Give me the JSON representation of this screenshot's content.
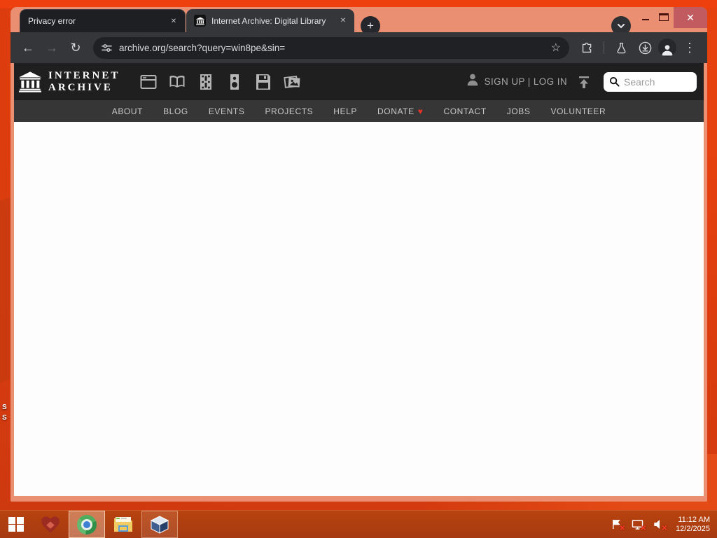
{
  "window": {
    "tabs": [
      {
        "title": "Privacy error"
      },
      {
        "title": "Internet Archive: Digital Library"
      }
    ],
    "new_tab_label": "+",
    "close_glyph": "✕",
    "url": "archive.org/search?query=win8pe&sin=",
    "menu_glyph": "⋮",
    "star_glyph": "☆",
    "back_glyph": "←",
    "forward_glyph": "→",
    "reload_glyph": "↻"
  },
  "site": {
    "logo": {
      "line1": "INTERNET",
      "line2": "ARCHIVE"
    },
    "account_label": "SIGN UP | LOG IN",
    "search_placeholder": "Search",
    "nav": {
      "about": "ABOUT",
      "blog": "BLOG",
      "events": "EVENTS",
      "projects": "PROJECTS",
      "help": "HELP",
      "donate": "DONATE",
      "contact": "CONTACT",
      "jobs": "JOBS",
      "volunteer": "VOLUNTEER"
    },
    "donate_heart": "♥",
    "media_types": [
      "web",
      "texts",
      "video",
      "audio",
      "software",
      "images"
    ]
  },
  "taskbar": {
    "time": "11:12 AM",
    "date": "12/2/2025",
    "apps": [
      "start",
      "heart-app",
      "chrome",
      "file-explorer",
      "virtualbox"
    ],
    "tray": [
      "action-center-alert",
      "network-disconnected",
      "audio-muted"
    ],
    "tray_x": "✕"
  },
  "desktop": {
    "icon_label_fragments": [
      "S",
      "S"
    ]
  },
  "colors": {
    "frame": "#eb8f72",
    "desktop": "#e2430f",
    "toolbar": "#35363a",
    "inactive_tab": "#1e1f23",
    "site_header": "#1f1f1f",
    "site_navbar": "#363636",
    "close_button": "#c25b60",
    "donate_heart": "#e63327"
  }
}
